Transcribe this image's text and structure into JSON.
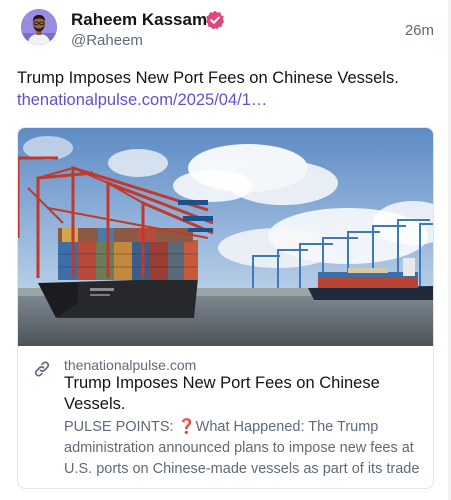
{
  "author": {
    "name": "Raheem Kassam",
    "handle": "@Raheem",
    "avatar_icon": "user-avatar",
    "verified_icon": "verified-badge-icon",
    "verified_color": "#e0457b"
  },
  "post": {
    "time": "26m",
    "text": "Trump Imposes New Port Fees on Chinese Vessels.",
    "link_text": "thenationalpulse.com/2025/04/1…",
    "link_color": "#5c52d6"
  },
  "link_card": {
    "image_description_icon": "port-photo",
    "link_icon": "link-icon",
    "domain": "thenationalpulse.com",
    "title": "Trump Imposes New Port Fees on Chinese Vessels.",
    "description": "PULSE POINTS: ❓What Happened: The Trump administration announced plans to impose new fees at U.S. ports on Chinese-made vessels as part of its trade"
  }
}
